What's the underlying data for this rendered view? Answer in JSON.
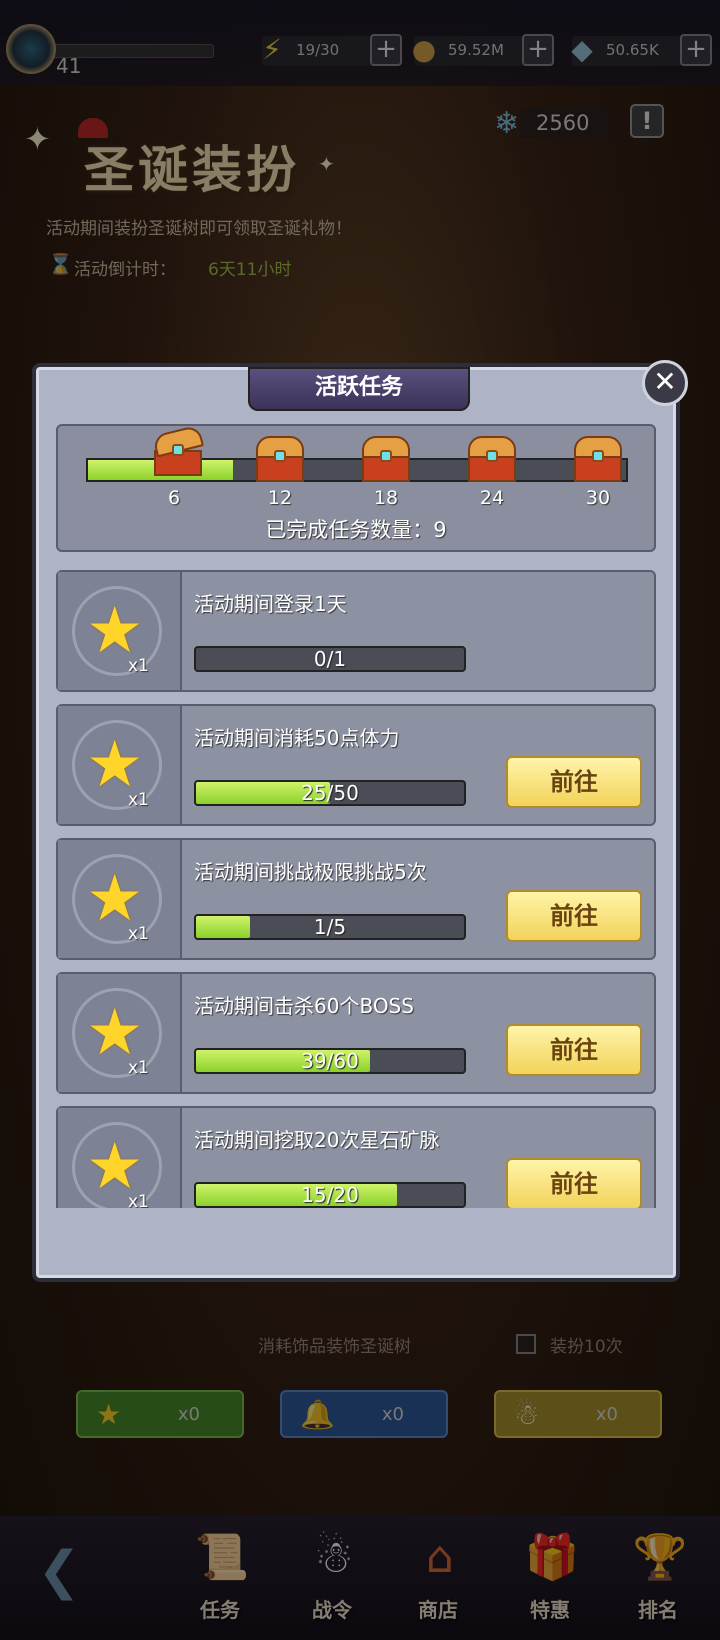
{
  "topbar": {
    "level": "41",
    "resources": [
      {
        "icon": "lightning-icon",
        "value": "19/30"
      },
      {
        "icon": "gold-coin-icon",
        "value": "59.52M"
      },
      {
        "icon": "crystal-icon",
        "value": "50.65K"
      }
    ]
  },
  "event": {
    "title": "圣诞装扮",
    "description": "活动期间装扮圣诞树即可领取圣诞礼物！",
    "countdown_label": "活动倒计时：",
    "countdown_value": "6天11小时",
    "snowflake_count": "2560",
    "info_label": "!"
  },
  "modal": {
    "title": "活跃任务",
    "close_label": "✕",
    "milestones": [
      {
        "value": "6",
        "reached": true
      },
      {
        "value": "12",
        "reached": false
      },
      {
        "value": "18",
        "reached": false
      },
      {
        "value": "24",
        "reached": false
      },
      {
        "value": "30",
        "reached": false
      }
    ],
    "milestone_progress": 0.27,
    "completed_text": "已完成任务数量：9",
    "tasks": [
      {
        "name": "活动期间登录1天",
        "reward_qty": "x1",
        "progress_text": "0/1",
        "progress": 0.0,
        "button": ""
      },
      {
        "name": "活动期间消耗50点体力",
        "reward_qty": "x1",
        "progress_text": "25/50",
        "progress": 0.5,
        "button": "前往"
      },
      {
        "name": "活动期间挑战极限挑战5次",
        "reward_qty": "x1",
        "progress_text": "1/5",
        "progress": 0.2,
        "button": "前往"
      },
      {
        "name": "活动期间击杀60个BOSS",
        "reward_qty": "x1",
        "progress_text": "39/60",
        "progress": 0.65,
        "button": "前往"
      },
      {
        "name": "活动期间挖取20次星石矿脉",
        "reward_qty": "x1",
        "progress_text": "15/20",
        "progress": 0.75,
        "button": "前往"
      }
    ]
  },
  "decoration": {
    "label": "消耗饰品装饰圣诞树",
    "checkbox_label": "装扮10次",
    "items": [
      {
        "icon": "star-ornament-icon",
        "count": "x0",
        "color": "#4a8a2c"
      },
      {
        "icon": "bell-ornament-icon",
        "count": "x0",
        "color": "#2f5a9a"
      },
      {
        "icon": "snowman-ornament-icon",
        "count": "x0",
        "color": "#a8902a"
      }
    ]
  },
  "bottom_nav": {
    "items": [
      {
        "label": "任务",
        "icon": "scroll-icon"
      },
      {
        "label": "战令",
        "icon": "snowman-icon"
      },
      {
        "label": "商店",
        "icon": "shop-icon"
      },
      {
        "label": "特惠",
        "icon": "gift-icon"
      },
      {
        "label": "排名",
        "icon": "trophy-icon"
      }
    ]
  }
}
